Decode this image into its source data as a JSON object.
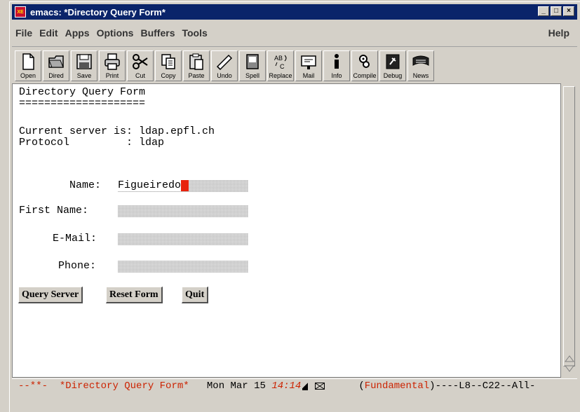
{
  "window": {
    "title": "emacs: *Directory Query Form*",
    "controls": {
      "minimize": "_",
      "maximize": "□",
      "close": "×"
    }
  },
  "menubar": {
    "items": [
      "File",
      "Edit",
      "Apps",
      "Options",
      "Buffers",
      "Tools"
    ],
    "help": "Help"
  },
  "toolbar": {
    "buttons": [
      {
        "label": "Open",
        "icon": "open-icon"
      },
      {
        "label": "Dired",
        "icon": "dired-icon"
      },
      {
        "label": "Save",
        "icon": "save-icon"
      },
      {
        "label": "Print",
        "icon": "print-icon"
      },
      {
        "label": "Cut",
        "icon": "scissors-icon"
      },
      {
        "label": "Copy",
        "icon": "copy-icon"
      },
      {
        "label": "Paste",
        "icon": "paste-icon"
      },
      {
        "label": "Undo",
        "icon": "undo-icon"
      },
      {
        "label": "Spell",
        "icon": "spell-icon"
      },
      {
        "label": "Replace",
        "icon": "replace-icon"
      },
      {
        "label": "Mail",
        "icon": "mail-icon"
      },
      {
        "label": "Info",
        "icon": "info-icon"
      },
      {
        "label": "Compile",
        "icon": "compile-icon"
      },
      {
        "label": "Debug",
        "icon": "debug-icon"
      },
      {
        "label": "News",
        "icon": "news-icon"
      }
    ]
  },
  "buffer": {
    "heading": "Directory Query Form",
    "underline": "====================",
    "server_line": "Current server is: ldap.epfl.ch",
    "protocol_line": "Protocol         : ldap",
    "fields": [
      {
        "label": "Name:",
        "value": "Figueiredo",
        "has_cursor": true
      },
      {
        "label": "First Name:",
        "value": ""
      },
      {
        "label": "E-Mail:",
        "value": ""
      },
      {
        "label": "Phone:",
        "value": ""
      }
    ],
    "buttons": {
      "query": "Query Server",
      "reset": "Reset Form",
      "quit": "Quit"
    }
  },
  "modeline": {
    "flags": "--**-",
    "buffer_name": "*Directory Query Form*",
    "date": "Mon Mar 15",
    "time": "14:14",
    "mode_open": "(",
    "mode": "Fundamental",
    "mode_close": ")",
    "position": "----L8--C22--All-"
  },
  "colors": {
    "titlebar": "#0a246a",
    "cursor": "#e8230d",
    "modeline_accent": "#cc2200",
    "chrome": "#d4d0c8"
  }
}
